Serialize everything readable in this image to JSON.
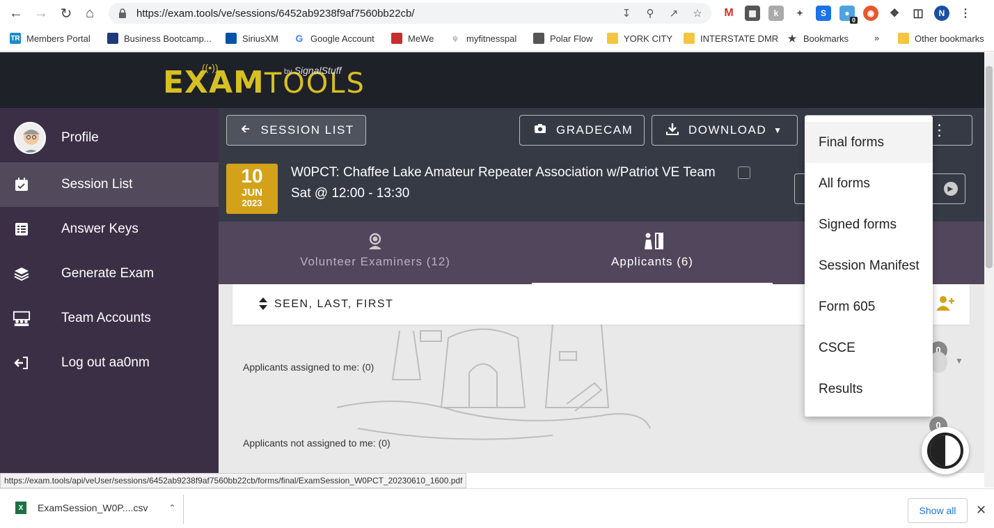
{
  "browser": {
    "url": "https://exam.tools/ve/sessions/6452ab9238f9af7560bb22cb/",
    "bookmarks": [
      {
        "label": "Members Portal",
        "icon": "TR"
      },
      {
        "label": "Business Bootcamp...",
        "icon": "bootcamp-icon"
      },
      {
        "label": "SiriusXM",
        "icon": "siriusxm-icon"
      },
      {
        "label": "Google Account",
        "icon": "G"
      },
      {
        "label": "MeWe",
        "icon": "mewe-icon"
      },
      {
        "label": "myfitnesspal",
        "icon": "mfp-icon"
      },
      {
        "label": "Polar Flow",
        "icon": "polar-icon"
      },
      {
        "label": "YORK CITY",
        "icon": "folder-icon"
      },
      {
        "label": "INTERSTATE DMR",
        "icon": "folder-icon"
      },
      {
        "label": "Bookmarks",
        "icon": "star-icon"
      }
    ],
    "overflow_label": "»",
    "other_bookmarks": "Other bookmarks",
    "profile_initial": "N",
    "ext_badge": "0",
    "status_url": "https://exam.tools/api/veUser/sessions/6452ab9238f9af7560bb22cb/forms/final/ExamSession_W0PCT_20230610_1600.pdf"
  },
  "logo": {
    "exam": "EXAM",
    "tools": "TOOLS",
    "by": "by",
    "signalstuff": "SignalStuff"
  },
  "sidebar": {
    "items": [
      {
        "label": "Profile",
        "icon": "avatar"
      },
      {
        "label": "Session List",
        "icon": "calendar-icon"
      },
      {
        "label": "Answer Keys",
        "icon": "list-icon"
      },
      {
        "label": "Generate Exam",
        "icon": "layers-icon"
      },
      {
        "label": "Team Accounts",
        "icon": "team-icon"
      },
      {
        "label": "Log out aa0nm",
        "icon": "logout-icon"
      }
    ]
  },
  "session": {
    "back_label": "SESSION LIST",
    "gradecam_label": "GRADECAM",
    "download_label": "DOWNLOAD",
    "date_day": "10",
    "date_month": "JUN",
    "date_year": "2023",
    "title": "W0PCT: Chaffee Lake Amateur Repeater Association w/Patriot VE Team",
    "time": "Sat @ 12:00 - 13:30"
  },
  "tabs": [
    {
      "label": "Volunteer Examiners (12)"
    },
    {
      "label": "Applicants (6)"
    }
  ],
  "sort": {
    "label": "SEEN, LAST, FIRST"
  },
  "applicants": {
    "assigned_label": "Applicants assigned to me: (0)",
    "not_assigned_label": "Applicants not assigned to me: (0)",
    "assigned_count": "0",
    "not_assigned_count": "0"
  },
  "download_menu": {
    "items": [
      "Final forms",
      "All forms",
      "Signed forms",
      "Session Manifest",
      "Form 605",
      "CSCE",
      "Results"
    ],
    "highlighted": "Final forms"
  },
  "download_shelf": {
    "file_label": "ExamSession_W0P....csv",
    "show_all": "Show all"
  },
  "colors": {
    "header_bg": "#1e2128",
    "sidebar_bg": "#3b2f45",
    "accent_gold": "#d4a21a",
    "session_bar": "#363a45",
    "tabs_bg": "#52465c"
  }
}
